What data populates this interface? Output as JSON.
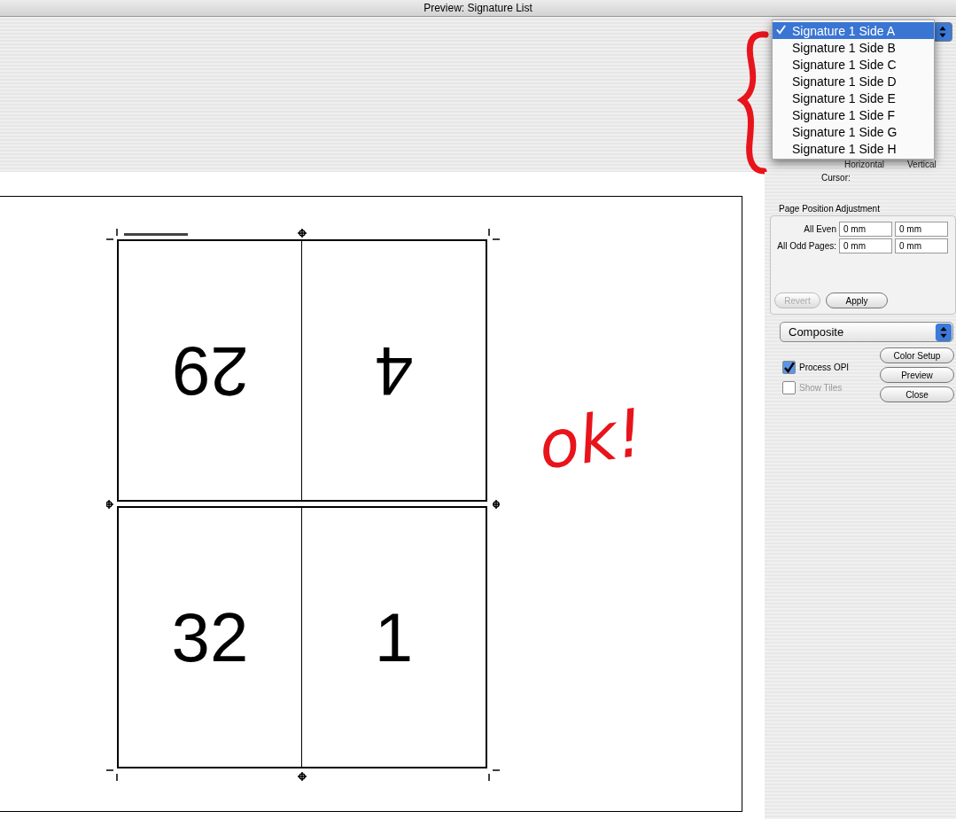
{
  "window": {
    "title": "Preview: Signature List"
  },
  "signature_menu": {
    "items": [
      {
        "label": "Signature 1 Side A",
        "selected": true
      },
      {
        "label": "Signature 1 Side B",
        "selected": false
      },
      {
        "label": "Signature 1 Side C",
        "selected": false
      },
      {
        "label": "Signature 1 Side D",
        "selected": false
      },
      {
        "label": "Signature 1 Side E",
        "selected": false
      },
      {
        "label": "Signature 1 Side F",
        "selected": false
      },
      {
        "label": "Signature 1 Side G",
        "selected": false
      },
      {
        "label": "Signature 1 Side H",
        "selected": false
      }
    ]
  },
  "cursor_info": {
    "column_labels": [
      "Horizontal",
      "Vertical"
    ],
    "cursor_label": "Cursor:"
  },
  "sheet": {
    "pages": [
      {
        "number": "29",
        "rotated": true
      },
      {
        "number": "4",
        "rotated": true
      },
      {
        "number": "32",
        "rotated": false
      },
      {
        "number": "1",
        "rotated": false
      }
    ]
  },
  "annotation": {
    "text": "ok!"
  },
  "page_position_adjustment": {
    "title": "Page Position Adjustment",
    "rows": [
      {
        "label": "All Even",
        "horizontal": "0 mm",
        "vertical": "0 mm"
      },
      {
        "label": "All Odd Pages:",
        "horizontal": "0 mm",
        "vertical": "0 mm"
      }
    ],
    "buttons": [
      {
        "label": "Revert",
        "disabled": true
      },
      {
        "label": "Apply",
        "disabled": false
      }
    ]
  },
  "output_mode": {
    "value": "Composite"
  },
  "options": [
    {
      "label": "Process OPI",
      "checked": true,
      "disabled": false
    },
    {
      "label": "Show Tiles",
      "checked": false,
      "disabled": true
    }
  ],
  "action_buttons": [
    "Color Setup",
    "Preview",
    "Close"
  ]
}
